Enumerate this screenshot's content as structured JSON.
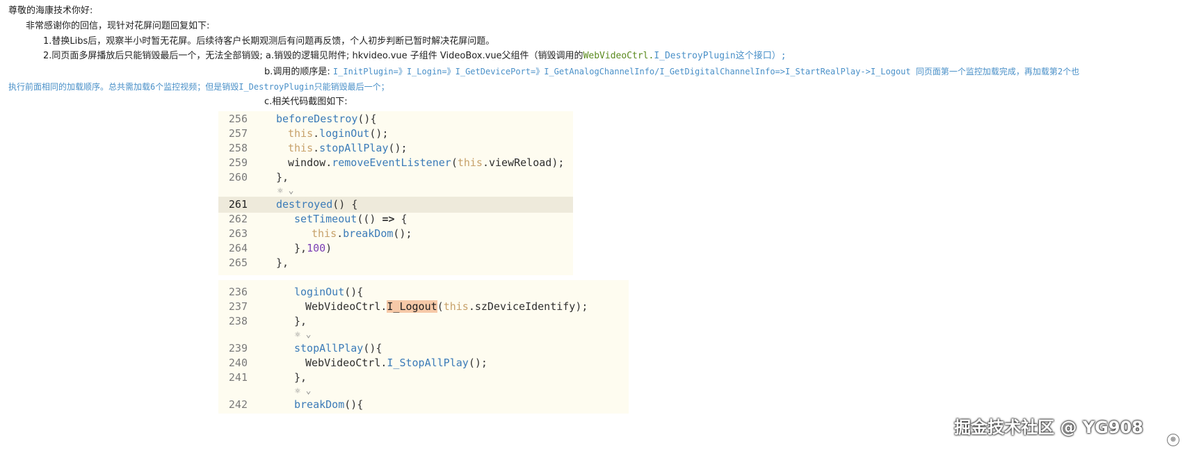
{
  "message": {
    "greeting": "尊敬的海康技术你好:",
    "thanks": "非常感谢你的回信，现针对花屏问题回复如下:",
    "item1": "1.替换Libs后，观察半小时暂无花屏。后续待客户长期观测后有问题再反馈，个人初步判断已暂时解决花屏问题。",
    "item2_prefix": "2.同页面多屏播放后只能销毁最后一个，无法全部销毁; a.销毁的逻辑见附件; hkvideo.vue 子组件   VideoBox.vue父组件（销毁调用的",
    "item2_code": "WebVideoCtrl.",
    "item2_code2": "I_DestroyPlugin这个接口）;",
    "item_b_prefix": "b.调用的顺序是:",
    "item_b_code": "I_InitPlugin=》I_Login=》I_GetDevicePort=》I_GetAnalogChannelInfo/I_GetDigitalChannelInfo=>I_StartRealPlay->I_Logout 同页面第一个监控加载完成，再加载第2个也",
    "item_b_cont": "执行前面相同的加载顺序。总共需加载6个监控视频；但是销毁I_DestroyPlugin只能销毁最后一个；",
    "item_c": "c.相关代码截图如下:"
  },
  "block1": {
    "lines": [
      {
        "num": "256",
        "parts": [
          [
            "fn",
            "beforeDestroy"
          ],
          [
            "punc",
            "(){"
          ]
        ]
      },
      {
        "num": "257",
        "parts": [
          [
            "kw-this",
            "this"
          ],
          [
            "punc",
            "."
          ],
          [
            "fn",
            "loginOut"
          ],
          [
            "punc",
            "();"
          ]
        ]
      },
      {
        "num": "258",
        "parts": [
          [
            "kw-this",
            "this"
          ],
          [
            "punc",
            "."
          ],
          [
            "fn",
            "stopAllPlay"
          ],
          [
            "punc",
            "();"
          ]
        ]
      },
      {
        "num": "259",
        "parts": [
          [
            "id",
            "window"
          ],
          [
            "punc",
            "."
          ],
          [
            "fn",
            "removeEventListener"
          ],
          [
            "punc",
            "("
          ],
          [
            "kw-this",
            "this"
          ],
          [
            "punc",
            "."
          ],
          [
            "id",
            "viewReload"
          ],
          [
            "punc",
            ");"
          ]
        ]
      },
      {
        "num": "260",
        "parts": [
          [
            "punc",
            "},"
          ]
        ]
      },
      {
        "num": "261",
        "parts": [
          [
            "fn",
            "destroyed"
          ],
          [
            "punc",
            "() {"
          ]
        ]
      },
      {
        "num": "262",
        "parts": [
          [
            "fn",
            "setTimeout"
          ],
          [
            "punc",
            "(() "
          ],
          [
            "arrow",
            "=>"
          ],
          [
            "punc",
            " {"
          ]
        ]
      },
      {
        "num": "263",
        "parts": [
          [
            "kw-this",
            "this"
          ],
          [
            "punc",
            "."
          ],
          [
            "fn",
            "breakDom"
          ],
          [
            "punc",
            "();"
          ]
        ]
      },
      {
        "num": "264",
        "parts": [
          [
            "punc",
            "},"
          ],
          [
            "num",
            "100"
          ],
          [
            "punc",
            ")"
          ]
        ]
      },
      {
        "num": "265",
        "parts": [
          [
            "punc",
            "},"
          ]
        ]
      }
    ],
    "codelens": "⚛ ⌄"
  },
  "block2": {
    "lines": [
      {
        "num": "236",
        "parts": [
          [
            "fn",
            "loginOut"
          ],
          [
            "punc",
            "(){"
          ]
        ]
      },
      {
        "num": "237",
        "parts": [
          [
            "id",
            "WebVideoCtrl"
          ],
          [
            "punc",
            "."
          ],
          [
            "match",
            "I_Logout"
          ],
          [
            "punc",
            "("
          ],
          [
            "kw-this",
            "this"
          ],
          [
            "punc",
            "."
          ],
          [
            "id",
            "szDeviceIdentify"
          ],
          [
            "punc",
            ");"
          ]
        ]
      },
      {
        "num": "238",
        "parts": [
          [
            "punc",
            "},"
          ]
        ]
      },
      {
        "num": "239",
        "parts": [
          [
            "fn",
            "stopAllPlay"
          ],
          [
            "punc",
            "(){"
          ]
        ]
      },
      {
        "num": "240",
        "parts": [
          [
            "id",
            "WebVideoCtrl"
          ],
          [
            "punc",
            "."
          ],
          [
            "fn",
            "I_StopAllPlay"
          ],
          [
            "punc",
            "();"
          ]
        ]
      },
      {
        "num": "241",
        "parts": [
          [
            "punc",
            "},"
          ]
        ]
      },
      {
        "num": "242",
        "parts": [
          [
            "fn",
            "breakDom"
          ],
          [
            "punc",
            "(){"
          ]
        ]
      }
    ],
    "codelens": "⚛ ⌄"
  },
  "watermark": "掘金技术社区 @ YG908",
  "zoom_icon": "⊕"
}
